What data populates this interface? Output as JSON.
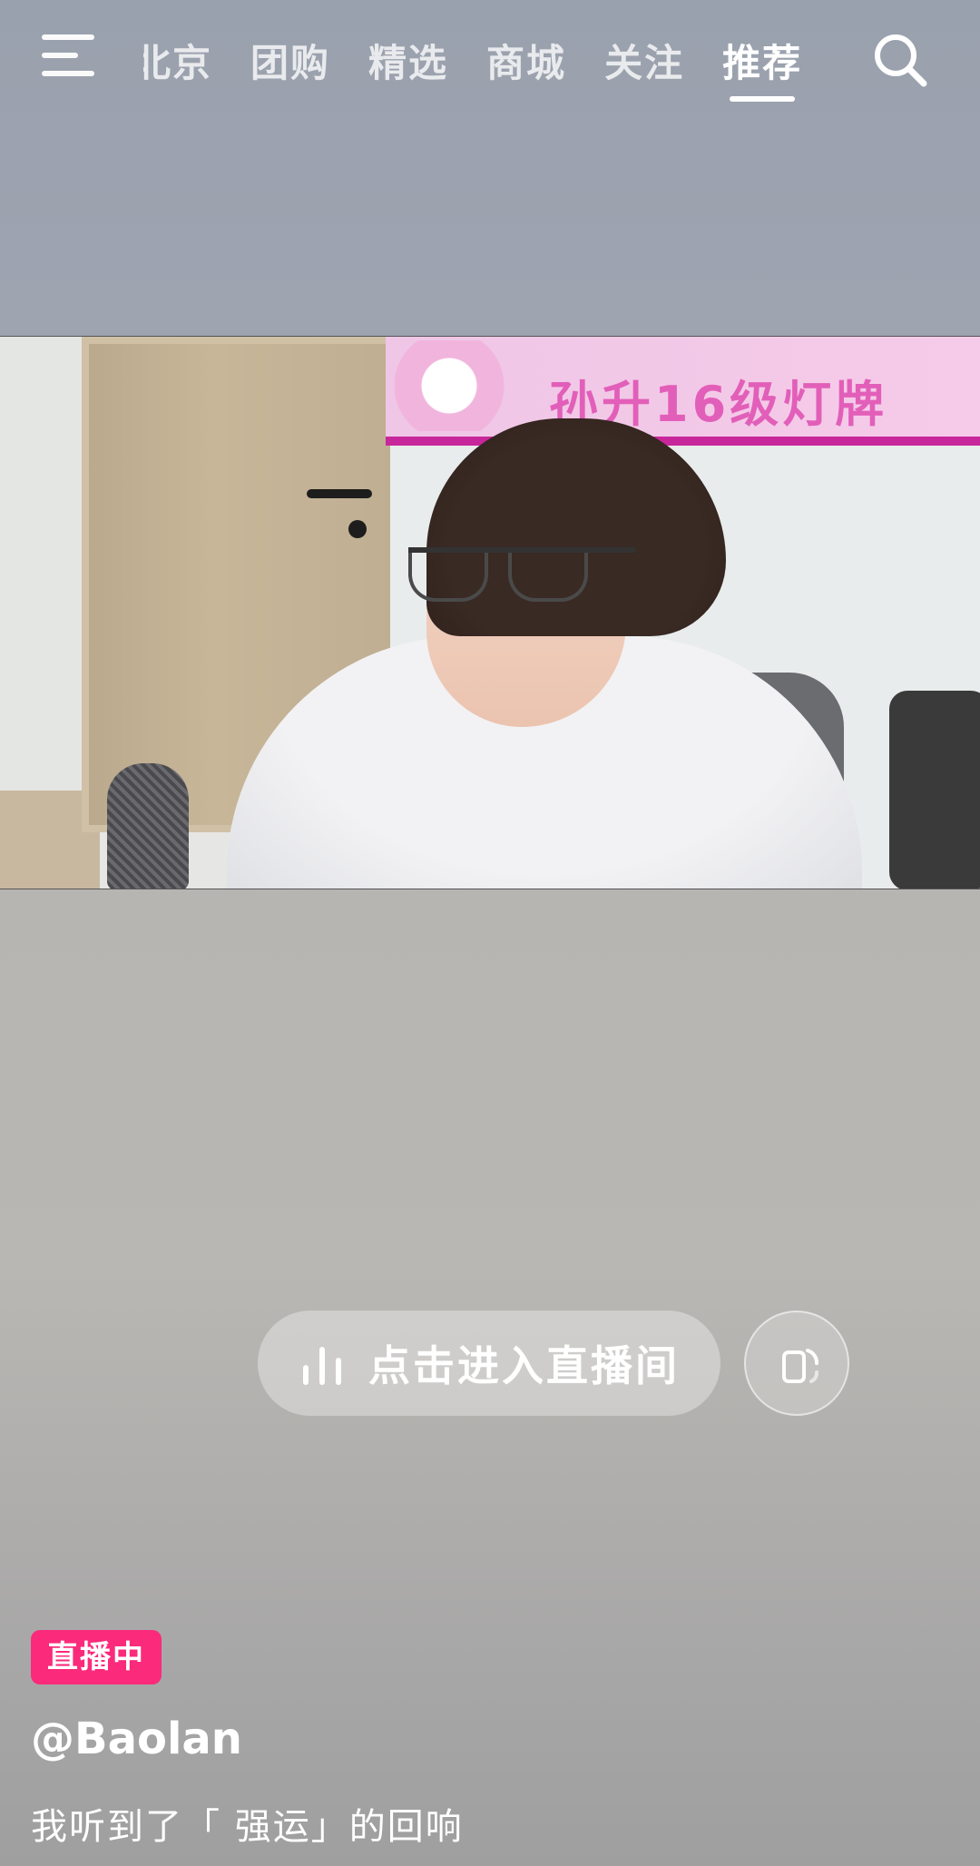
{
  "nav": {
    "tabs": [
      "北京",
      "团购",
      "精选",
      "商城",
      "关注",
      "推荐"
    ],
    "active_tab": "推荐"
  },
  "video": {
    "banner_text": "孙升16级灯牌"
  },
  "live": {
    "enter_label": "点击进入直播间",
    "badge": "直播中",
    "author": "@Baolan",
    "caption": "我听到了「 强运」的回响"
  },
  "colors": {
    "badge": "#fb2a7b",
    "banner_border": "#c8279b"
  },
  "icons": {
    "menu": "menu-icon",
    "search": "search-icon",
    "bars": "audio-bars-icon",
    "rotate": "rotate-screen-icon"
  }
}
